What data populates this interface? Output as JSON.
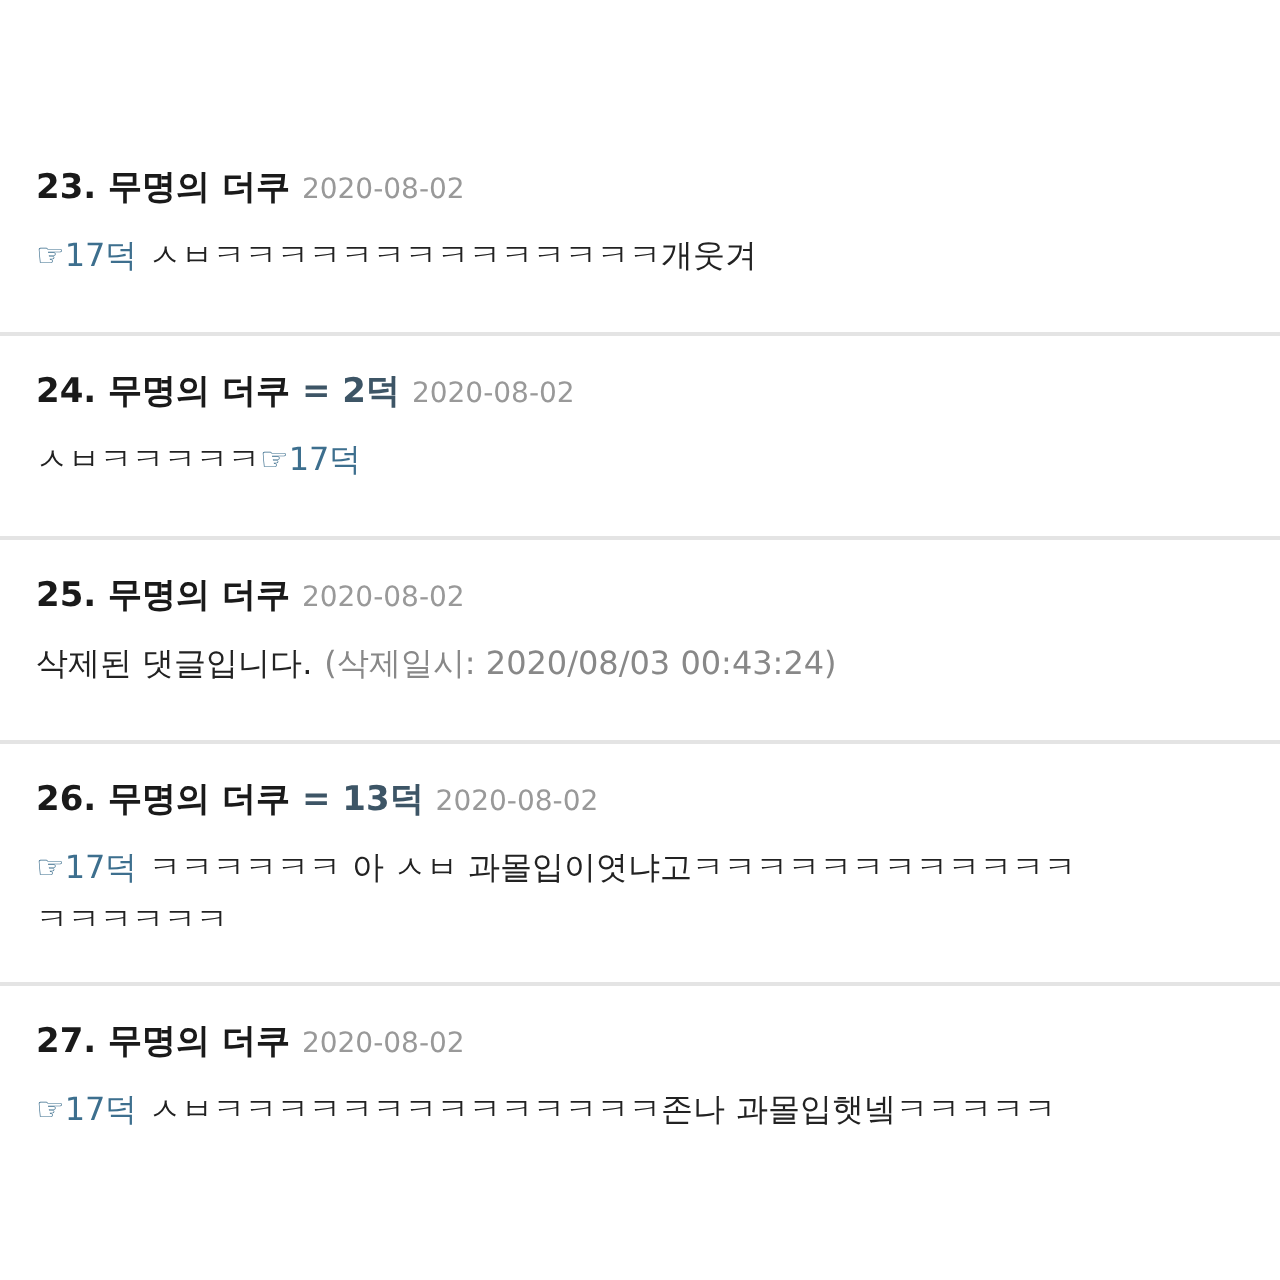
{
  "comments": [
    {
      "number": "23.",
      "author": "무명의 더쿠",
      "date": "2020-08-02",
      "body": [
        {
          "kind": "ref",
          "text": "☞17덕"
        },
        {
          "kind": "text",
          "text": "ㅅㅂㅋㅋㅋㅋㅋㅋㅋㅋㅋㅋㅋㅋㅋㅋ개웃겨"
        }
      ]
    },
    {
      "number": "24.",
      "author": "무명의 더쿠",
      "reply_to": "= 2덕",
      "date": "2020-08-02",
      "body": [
        {
          "kind": "text",
          "text": "ㅅㅂㅋㅋㅋㅋㅋ"
        },
        {
          "kind": "ref",
          "text": "☞17덕"
        }
      ]
    },
    {
      "number": "25.",
      "author": "무명의 더쿠",
      "date": "2020-08-02",
      "body": [
        {
          "kind": "text",
          "text": "삭제된 댓글입니다."
        },
        {
          "kind": "note",
          "text": "(삭제일시: 2020/08/03 00:43:24)"
        }
      ]
    },
    {
      "number": "26.",
      "author": "무명의 더쿠",
      "reply_to": "= 13덕",
      "date": "2020-08-02",
      "body": [
        {
          "kind": "ref",
          "text": "☞17덕"
        },
        {
          "kind": "text",
          "text": "ㅋㅋㅋㅋㅋㅋ 아 ㅅㅂ 과몰입이엿냐고ㅋㅋㅋㅋㅋㅋㅋㅋㅋㅋㅋㅋ"
        },
        {
          "kind": "text",
          "new_line": true,
          "text": "ㅋㅋㅋㅋㅋㅋ"
        }
      ]
    },
    {
      "number": "27.",
      "author": "무명의 더쿠",
      "date": "2020-08-02",
      "body": [
        {
          "kind": "ref",
          "text": "☞17덕"
        },
        {
          "kind": "text",
          "text": "ㅅㅂㅋㅋㅋㅋㅋㅋㅋㅋㅋㅋㅋㅋㅋㅋ존나 과몰입햇넼ㅋㅋㅋㅋㅋ"
        }
      ]
    }
  ]
}
